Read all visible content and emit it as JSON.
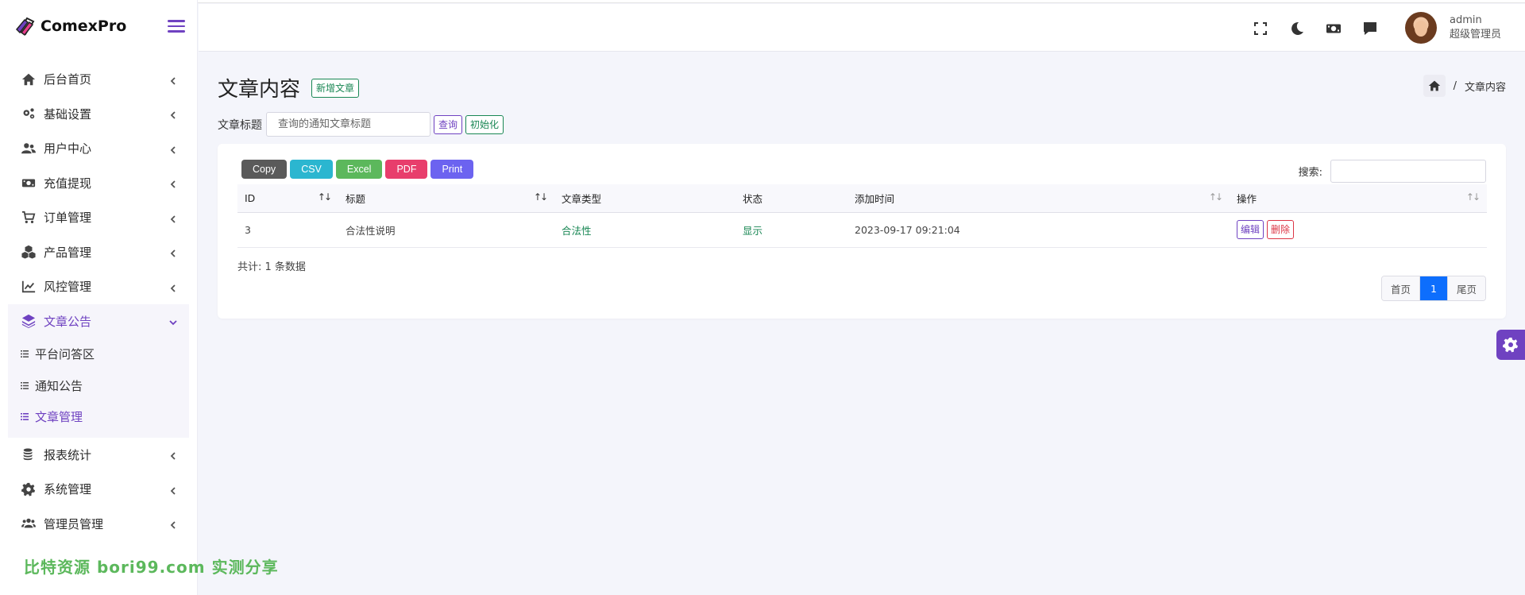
{
  "brand": {
    "name": "ComexPro"
  },
  "sidebar": {
    "items": [
      {
        "label": "后台首页",
        "icon": "home-icon"
      },
      {
        "label": "基础设置",
        "icon": "cogs-icon"
      },
      {
        "label": "用户中心",
        "icon": "users-icon"
      },
      {
        "label": "充值提现",
        "icon": "money-icon"
      },
      {
        "label": "订单管理",
        "icon": "cart-icon"
      },
      {
        "label": "产品管理",
        "icon": "cubes-icon"
      },
      {
        "label": "风控管理",
        "icon": "chart-line-icon"
      },
      {
        "label": "文章公告",
        "icon": "layers-icon",
        "active": true
      }
    ],
    "submenu": [
      {
        "label": "平台问答区"
      },
      {
        "label": "通知公告"
      },
      {
        "label": "文章管理",
        "active": true
      }
    ],
    "items_after": [
      {
        "label": "报表统计",
        "icon": "coins-icon"
      },
      {
        "label": "系统管理",
        "icon": "gear-icon"
      },
      {
        "label": "管理员管理",
        "icon": "user-group-icon"
      }
    ]
  },
  "watermark": "比特资源 bori99.com 实测分享",
  "header": {
    "user_name": "admin",
    "user_role": "超级管理员"
  },
  "page": {
    "title": "文章内容",
    "add_button": "新增文章",
    "breadcrumb_current": "文章内容",
    "breadcrumb_sep": "/"
  },
  "filter": {
    "label": "文章标题",
    "placeholder": "查询的通知文章标题",
    "query_button": "查询",
    "reset_button": "初始化"
  },
  "table_tools": {
    "buttons": [
      {
        "label": "Copy",
        "color": "#5a5a5a"
      },
      {
        "label": "CSV",
        "color": "#2bb6d0"
      },
      {
        "label": "Excel",
        "color": "#5cb85c"
      },
      {
        "label": "PDF",
        "color": "#e83e6c"
      },
      {
        "label": "Print",
        "color": "#6c63f0"
      }
    ],
    "search_label": "搜索:"
  },
  "table": {
    "columns": [
      "ID",
      "标题",
      "文章类型",
      "状态",
      "添加时间",
      "操作"
    ],
    "rows": [
      {
        "id": "3",
        "title": "合法性说明",
        "type": "合法性",
        "status": "显示",
        "time": "2023-09-17 09:21:04",
        "edit": "编辑",
        "delete": "删除"
      }
    ],
    "info": "共计: 1 条数据"
  },
  "pager": {
    "first": "首页",
    "current": "1",
    "last": "尾页"
  },
  "colors": {
    "accent": "#6f42c1",
    "success": "#198754",
    "danger": "#dc3545",
    "primary": "#0d6efd"
  }
}
